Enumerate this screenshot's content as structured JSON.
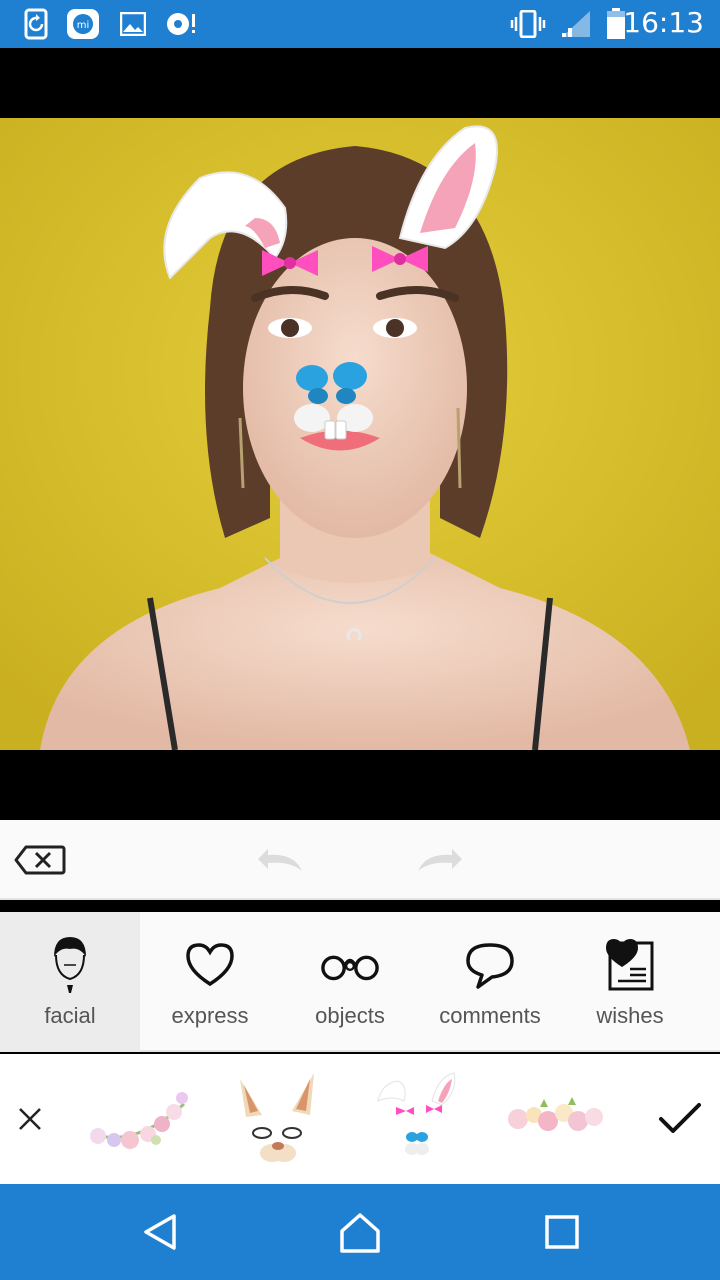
{
  "status_bar": {
    "time": "16:13",
    "icons": [
      "sync-icon",
      "mi-icon",
      "gallery-icon",
      "media-icon",
      "vibrate-icon",
      "signal-icon",
      "battery-icon"
    ]
  },
  "editor": {
    "actions": [
      "clear-icon",
      "undo-icon",
      "redo-icon"
    ]
  },
  "categories": [
    {
      "label": "facial",
      "icon": "face-icon",
      "active": true
    },
    {
      "label": "express",
      "icon": "heart-icon",
      "active": false
    },
    {
      "label": "objects",
      "icon": "glasses-icon",
      "active": false
    },
    {
      "label": "comments",
      "icon": "speech-bubble-icon",
      "active": false
    },
    {
      "label": "wishes",
      "icon": "heart-card-icon",
      "active": false
    }
  ],
  "stickers": [
    "flower-crown",
    "cat-ears",
    "bunny-ears",
    "flower-band"
  ],
  "nav": [
    "back-icon",
    "home-icon",
    "recents-icon"
  ],
  "colors": {
    "accent": "#1f7fd0",
    "photo_background": "#d9c32c",
    "sticker_pink": "#ff4fbf",
    "butterfly_blue": "#2aa2e0"
  }
}
